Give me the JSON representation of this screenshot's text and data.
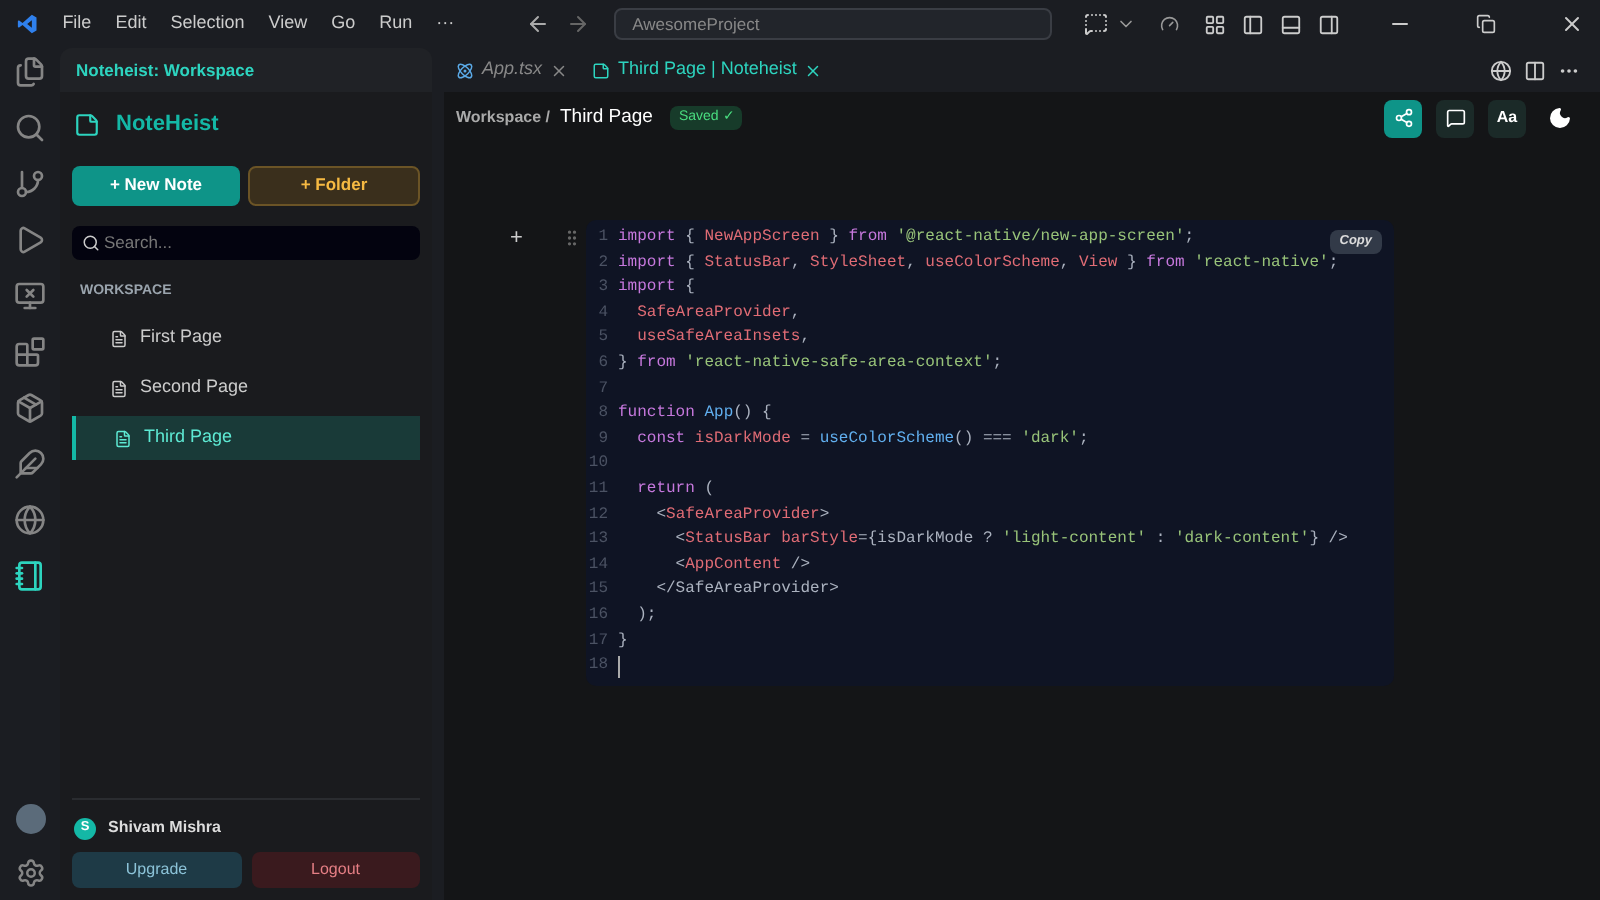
{
  "title_bar": {
    "menu": [
      "File",
      "Edit",
      "Selection",
      "View",
      "Go",
      "Run",
      "···"
    ],
    "search": "AwesomeProject"
  },
  "sidebar": {
    "title": "Noteheist: Workspace",
    "brand": "NoteHeist",
    "new_note": "+ New Note",
    "new_folder": "+ Folder",
    "search": {
      "placeholder": "Search..."
    },
    "section": "WORKSPACE",
    "pages": [
      {
        "label": "First Page",
        "selected": false
      },
      {
        "label": "Second Page",
        "selected": false
      },
      {
        "label": "Third Page",
        "selected": true
      }
    ],
    "user": {
      "initial": "S",
      "name": "Shivam Mishra"
    },
    "upgrade": "Upgrade",
    "logout": "Logout"
  },
  "tabs": [
    {
      "label": "App.tsx",
      "selected": false
    },
    {
      "label": "Third Page | Noteheist",
      "selected": true
    }
  ],
  "editor": {
    "breadcrumb": "Workspace /",
    "page": "Third Page",
    "status": "Saved ✓",
    "font_button": "Aa",
    "add": "+",
    "copy": "Copy",
    "code": [
      {
        "number": "1",
        "segments": [
          {
            "kind": "keyword",
            "text": "import"
          },
          {
            "kind": "plain",
            "text": " { "
          },
          {
            "kind": "name",
            "text": "NewAppScreen"
          },
          {
            "kind": "plain",
            "text": " } "
          },
          {
            "kind": "keyword",
            "text": "from "
          },
          {
            "kind": "string",
            "text": "'@react-native/new-app-screen'"
          },
          {
            "kind": "plain",
            "text": ";"
          }
        ]
      },
      {
        "number": "2",
        "segments": [
          {
            "kind": "keyword",
            "text": "import"
          },
          {
            "kind": "plain",
            "text": " { "
          },
          {
            "kind": "name",
            "text": "StatusBar"
          },
          {
            "kind": "plain",
            "text": ", "
          },
          {
            "kind": "name",
            "text": "StyleSheet"
          },
          {
            "kind": "plain",
            "text": ", "
          },
          {
            "kind": "name",
            "text": "useColorScheme"
          },
          {
            "kind": "plain",
            "text": ", "
          },
          {
            "kind": "name",
            "text": "View"
          },
          {
            "kind": "plain",
            "text": " } "
          },
          {
            "kind": "keyword",
            "text": "from "
          },
          {
            "kind": "string",
            "text": "'react-native'"
          },
          {
            "kind": "plain",
            "text": ";"
          }
        ]
      },
      {
        "number": "3",
        "segments": [
          {
            "kind": "keyword",
            "text": "import"
          },
          {
            "kind": "plain",
            "text": " {"
          }
        ]
      },
      {
        "number": "4",
        "segments": [
          {
            "kind": "name",
            "text": "  SafeAreaProvider"
          },
          {
            "kind": "plain",
            "text": ","
          }
        ]
      },
      {
        "number": "5",
        "segments": [
          {
            "kind": "name",
            "text": "  useSafeAreaInsets"
          },
          {
            "kind": "plain",
            "text": ","
          }
        ]
      },
      {
        "number": "6",
        "segments": [
          {
            "kind": "plain",
            "text": "} "
          },
          {
            "kind": "keyword",
            "text": "from "
          },
          {
            "kind": "string",
            "text": "'react-native-safe-area-context'"
          },
          {
            "kind": "plain",
            "text": ";"
          }
        ]
      },
      {
        "number": "7"
      },
      {
        "number": "8",
        "segments": [
          {
            "kind": "keyword",
            "text": "function "
          },
          {
            "kind": "function",
            "text": "App"
          },
          {
            "kind": "plain",
            "text": "() {"
          }
        ]
      },
      {
        "number": "9",
        "segments": [
          {
            "kind": "keyword",
            "text": "  const "
          },
          {
            "kind": "name",
            "text": "isDarkMode"
          },
          {
            "kind": "plain",
            "text": " = "
          },
          {
            "kind": "function",
            "text": "useColorScheme"
          },
          {
            "kind": "plain",
            "text": "() === "
          },
          {
            "kind": "string",
            "text": "'dark'"
          },
          {
            "kind": "plain",
            "text": ";"
          }
        ]
      },
      {
        "number": "10"
      },
      {
        "number": "11",
        "segments": [
          {
            "kind": "keyword",
            "text": "  return"
          },
          {
            "kind": "plain",
            "text": " ("
          }
        ]
      },
      {
        "number": "12",
        "segments": [
          {
            "kind": "plain",
            "text": "    <"
          },
          {
            "kind": "name",
            "text": "SafeAreaProvider"
          },
          {
            "kind": "plain",
            "text": ">"
          }
        ]
      },
      {
        "number": "13",
        "segments": [
          {
            "kind": "plain",
            "text": "      <"
          },
          {
            "kind": "name",
            "text": "StatusBar barStyle"
          },
          {
            "kind": "plain",
            "text": "={isDarkMode ? "
          },
          {
            "kind": "string",
            "text": "'light-content'"
          },
          {
            "kind": "plain",
            "text": " : "
          },
          {
            "kind": "string",
            "text": "'dark-content'"
          },
          {
            "kind": "plain",
            "text": "} />"
          }
        ]
      },
      {
        "number": "14",
        "segments": [
          {
            "kind": "plain",
            "text": "      <"
          },
          {
            "kind": "name",
            "text": "AppContent"
          },
          {
            "kind": "plain",
            "text": " />"
          }
        ]
      },
      {
        "number": "15",
        "segments": [
          {
            "kind": "plain",
            "text": "    </SafeAreaProvider>"
          }
        ]
      },
      {
        "number": "16",
        "segments": [
          {
            "kind": "plain",
            "text": "  );"
          }
        ]
      },
      {
        "number": "17",
        "segments": [
          {
            "kind": "plain",
            "text": "}"
          }
        ]
      },
      {
        "number": "18"
      }
    ]
  }
}
